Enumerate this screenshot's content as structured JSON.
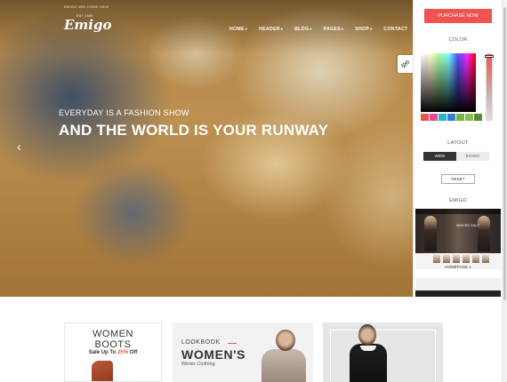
{
  "header": {
    "welcome_text": "EMIGO WELCOME 9000",
    "logo_text": "Emigo",
    "logo_sup": "EST 1969",
    "nav": [
      {
        "label": "HOME",
        "has_dropdown": true
      },
      {
        "label": "HEADER",
        "has_dropdown": true
      },
      {
        "label": "BLOG",
        "has_dropdown": true
      },
      {
        "label": "PAGES",
        "has_dropdown": true
      },
      {
        "label": "SHOP",
        "has_dropdown": true
      },
      {
        "label": "CONTACT",
        "has_dropdown": false
      }
    ],
    "caret_glyph": "▾"
  },
  "hero": {
    "subtitle": "EVERYDAY IS A FASHION SHOW",
    "title": "AND THE WORLD IS YOUR RUNWAY",
    "prev_arrow": "‹"
  },
  "customizer": {
    "purchase_label": "PURCHASE NOW",
    "color_heading": "COLOR",
    "swatches": [
      "#f0524f",
      "#e84a8b",
      "#29b6c6",
      "#3a7fd5",
      "#7cb342",
      "#8bc34a",
      "#5d8a3a"
    ],
    "layout_heading": "LAYOUT",
    "layout_options": [
      "WIDE",
      "BOXED"
    ],
    "layout_selected": "WIDE",
    "reset_label": "RESET",
    "demo_heading": "EMIGO",
    "demo_thumb_text": "WINTER SALE",
    "demo_caption": "HOMEPAGE 1",
    "accent_color": "#f0524f"
  },
  "banners": {
    "boots_line1": "WOMEN",
    "boots_line2": "BOOTS",
    "boots_sale_prefix": "Sale Up To ",
    "boots_sale_pct": "25%",
    "boots_sale_suffix": " Off",
    "lookbook_label": "LOOKBOOK",
    "womens_title": "WOMEN'S",
    "womens_sub": "Winter Clothing"
  }
}
